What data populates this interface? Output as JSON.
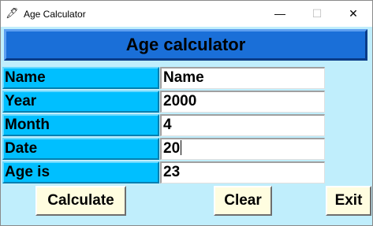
{
  "window": {
    "title": "Age Calculator",
    "icon": "feather-icon",
    "controls": {
      "minimize": "—",
      "maximize": "☐",
      "close": "✕"
    }
  },
  "header": {
    "title": "Age calculator"
  },
  "form": {
    "rows": [
      {
        "label": "Name",
        "value": "Name"
      },
      {
        "label": "Year",
        "value": "2000"
      },
      {
        "label": "Month",
        "value": "4"
      },
      {
        "label": "Date",
        "value": "20"
      },
      {
        "label": "Age is",
        "value": "23"
      }
    ]
  },
  "buttons": {
    "calculate": "Calculate",
    "clear": "Clear",
    "exit": "Exit"
  },
  "colors": {
    "background": "#c0eefc",
    "header": "#1a6fd8",
    "label": "#00bfff",
    "button": "#fffde0"
  }
}
